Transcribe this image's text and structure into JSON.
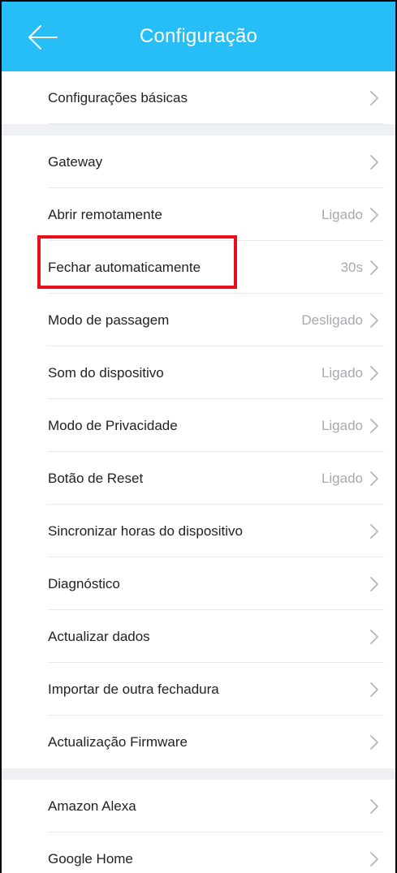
{
  "header": {
    "title": "Configuração",
    "back_icon": "arrow-left-icon",
    "color": "#27bdf7"
  },
  "sections": [
    {
      "items": [
        {
          "label": "Configurações básicas",
          "value": ""
        }
      ]
    },
    {
      "items": [
        {
          "label": "Gateway",
          "value": ""
        },
        {
          "label": "Abrir remotamente",
          "value": "Ligado"
        },
        {
          "label": "Fechar automaticamente",
          "value": "30s"
        },
        {
          "label": "Modo de passagem",
          "value": "Desligado"
        },
        {
          "label": "Som do dispositivo",
          "value": "Ligado"
        },
        {
          "label": "Modo de Privacidade",
          "value": "Ligado"
        },
        {
          "label": "Botão de Reset",
          "value": "Ligado"
        },
        {
          "label": "Sincronizar horas do dispositivo",
          "value": ""
        },
        {
          "label": "Diagnóstico",
          "value": ""
        },
        {
          "label": "Actualizar dados",
          "value": ""
        },
        {
          "label": "Importar de outra fechadura",
          "value": ""
        },
        {
          "label": "Actualização Firmware",
          "value": ""
        }
      ]
    },
    {
      "items": [
        {
          "label": "Amazon Alexa",
          "value": ""
        },
        {
          "label": "Google Home",
          "value": ""
        }
      ]
    }
  ],
  "colors": {
    "highlight": "#e8101a",
    "value_text": "#a7a9ad",
    "section_gap": "#eef0f3"
  }
}
